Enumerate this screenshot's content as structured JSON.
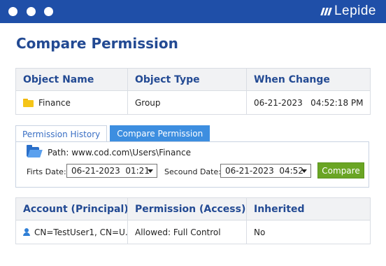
{
  "brand": {
    "name": "Lepide"
  },
  "page": {
    "title": "Compare Permission"
  },
  "object_table": {
    "headers": [
      "Object Name",
      "Object Type",
      "When Change"
    ],
    "row": {
      "name": "Finance",
      "type": "Group",
      "when": "06-21-2023   04:52:18 PM"
    }
  },
  "tabs": [
    {
      "label": "Permission History",
      "active": false
    },
    {
      "label": "Compare Permission",
      "active": true
    }
  ],
  "compare": {
    "path_text": "Path: www.cod.com\\Users\\Finance",
    "first_date_label": "Firts Date:",
    "first_date_value": "06-21-2023  01:21",
    "second_date_label": "Secound Date:",
    "second_date_value": "06-21-2023  04:52",
    "button_label": "Compare"
  },
  "permission_table": {
    "headers": [
      "Account (Principal)",
      "Permission (Access)",
      "Inherited"
    ],
    "row": {
      "account": "CN=TestUser1, CN=U...",
      "permission": "Allowed: Full Control",
      "inherited": "No"
    }
  },
  "colors": {
    "titlebar": "#1f4fa8",
    "heading": "#234a93",
    "tab_active": "#3d8ee0",
    "compare_button": "#6aa524"
  },
  "icons": [
    "window-dot",
    "lepide-logo-icon",
    "folder-icon",
    "open-folder-icon",
    "dropdown-caret-icon",
    "user-icon"
  ]
}
